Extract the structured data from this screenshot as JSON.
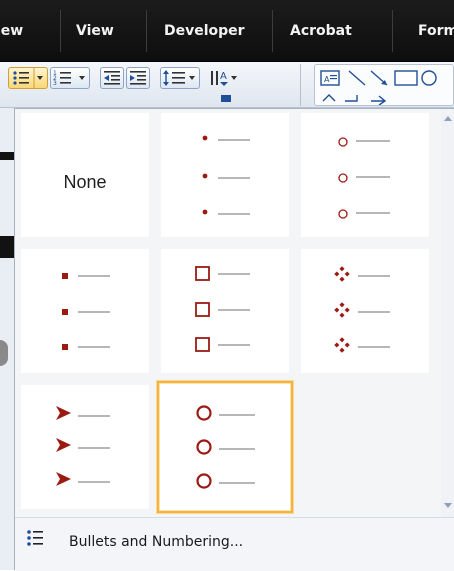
{
  "ribbon": {
    "tabs": [
      {
        "label": "iew"
      },
      {
        "label": "View"
      },
      {
        "label": "Developer"
      },
      {
        "label": "Acrobat"
      },
      {
        "label": "Form"
      }
    ]
  },
  "gallery": {
    "none_label": "None",
    "accent_color": "#9b1b13",
    "selected_index": 7,
    "items": [
      {
        "style": "none",
        "label": "None"
      },
      {
        "style": "small-filled-dot"
      },
      {
        "style": "hollow-circle-small"
      },
      {
        "style": "filled-square"
      },
      {
        "style": "hollow-square"
      },
      {
        "style": "four-diamond"
      },
      {
        "style": "arrowhead"
      },
      {
        "style": "hollow-circle-large",
        "selected": true
      }
    ]
  },
  "footer": {
    "label": "Bullets and Numbering..."
  }
}
